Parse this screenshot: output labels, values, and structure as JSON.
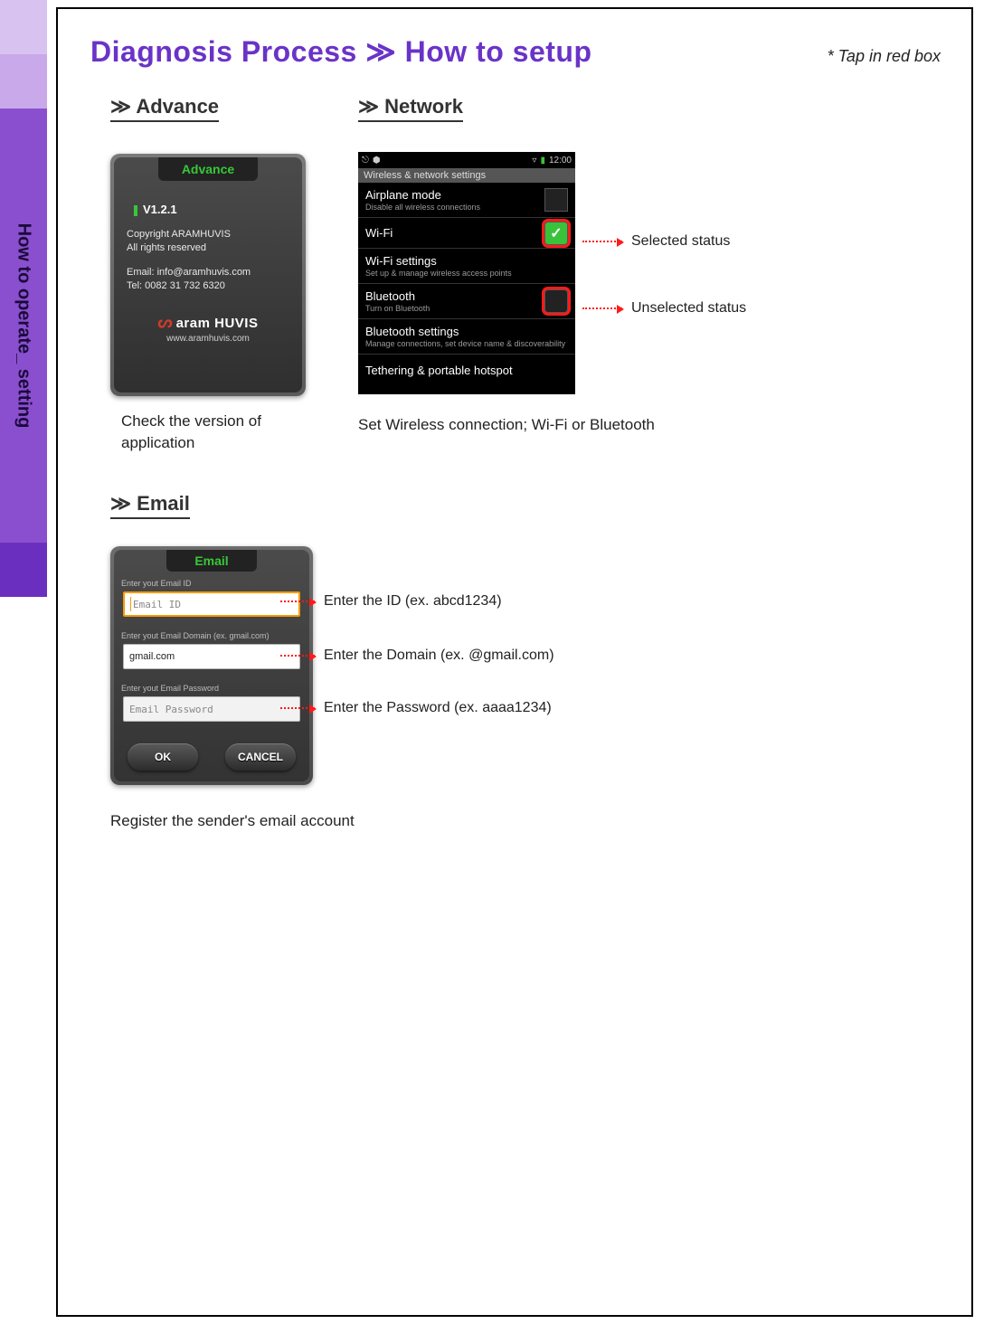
{
  "sidebar": {
    "label": "How to operate_ setting"
  },
  "header": {
    "title": "Diagnosis Process ≫ How to setup",
    "note": "* Tap in red box"
  },
  "sections": {
    "advance": {
      "heading": "≫ Advance",
      "tab": "Advance",
      "version": "V1.2.1",
      "copyright": "Copyright ARAMHUVIS\nAll rights reserved",
      "contact": "Email: info@aramhuvis.com\nTel: 0082 31 732 6320",
      "logo_name": "aram HUVIS",
      "logo_url": "www.aramhuvis.com",
      "caption": "Check the version of application"
    },
    "network": {
      "heading": "≫ Network",
      "status_time": "12:00",
      "settings_header": "Wireless & network settings",
      "rows": {
        "airplane": {
          "title": "Airplane mode",
          "sub": "Disable all wireless connections"
        },
        "wifi": {
          "title": "Wi-Fi"
        },
        "wifiset": {
          "title": "Wi-Fi settings",
          "sub": "Set up & manage wireless access points"
        },
        "bt": {
          "title": "Bluetooth",
          "sub": "Turn on Bluetooth"
        },
        "btset": {
          "title": "Bluetooth settings",
          "sub": "Manage connections, set device name & discoverability"
        },
        "tether": {
          "title": "Tethering & portable hotspot"
        }
      },
      "annot_selected": "Selected status",
      "annot_unselected": "Unselected status",
      "caption": "Set Wireless connection; Wi-Fi or Bluetooth"
    },
    "email": {
      "heading": "≫ Email",
      "tab": "Email",
      "label_id": "Enter yout Email ID",
      "placeholder_id": "Email ID",
      "label_domain": "Enter yout Email Domain (ex. gmail.com)",
      "value_domain": "gmail.com",
      "label_pw": "Enter yout Email Password",
      "placeholder_pw": "Email Password",
      "btn_ok": "OK",
      "btn_cancel": "CANCEL",
      "annot_id": "Enter the ID (ex. abcd1234)",
      "annot_domain": "Enter the Domain (ex. @gmail.com)",
      "annot_pw": "Enter the Password (ex. aaaa1234)",
      "caption": "Register the sender's email account"
    }
  }
}
